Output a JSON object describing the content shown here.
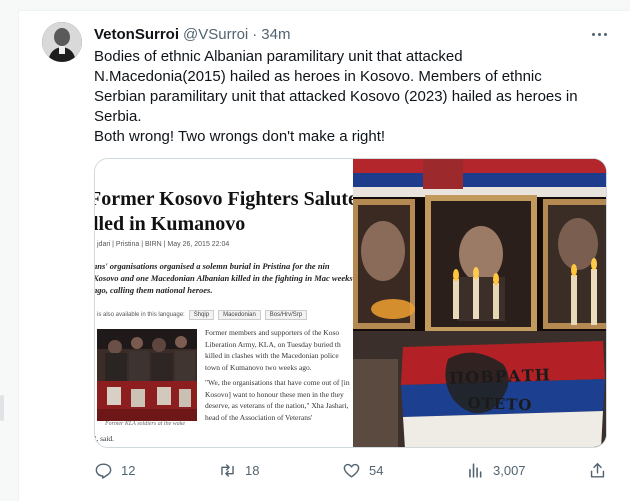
{
  "tweet": {
    "author_name": "VetonSurroi",
    "handle": "@VSurroi",
    "separator": "·",
    "time": "34m",
    "text_lines": [
      "Bodies of ethnic Albanian paramilitary unit that attacked",
      "N.Macedonia(2015) hailed as heroes in Kosovo. Members of ethnic",
      "Serbian paramilitary unit that attacked Kosovo (2023) hailed as heroes in",
      "Serbia.",
      "Both wrong! Two wrongs don't make a right!"
    ]
  },
  "media": {
    "article": {
      "headline_line1": "Former Kosovo Fighters Salute M",
      "headline_line2": "lled in Kumanovo",
      "meta": "jdari | Pristina | BIRN | May 26, 2015 22:04",
      "lead": "ans' organisations organised a solemn burial in Pristina for the nin Kosovo and one Macedonian Albanian killed in the fighting in Mac weeks ago, calling them national heroes.",
      "lang_label": "is also available in this language:",
      "lang_options": [
        "Shqip",
        "Macedonian",
        "Bos/Hrv/Srp"
      ],
      "body_p1": "Former members and supporters of the Koso Liberation Army, KLA, on Tuesday buried th killed in clashes with the Macedonian police town of Kumanovo two weeks ago.",
      "body_p2": "\"We, the organisations that have come out of [in Kosovo] want to honour these men in the they deserve, as veterans of the nation,\" Xha Jashari, head of the Association of Veterans'",
      "caption": "Former KLA soldiers at the wake",
      "said": "', said."
    },
    "photo": {
      "banner_line1": "ПОВРАТН",
      "banner_line2": "ОТЕТО"
    }
  },
  "actions": {
    "replies": "12",
    "reposts": "18",
    "likes": "54",
    "views": "3,007"
  },
  "colors": {
    "text": "#0f1419",
    "secondary": "#536471",
    "border": "#cfd9de"
  }
}
